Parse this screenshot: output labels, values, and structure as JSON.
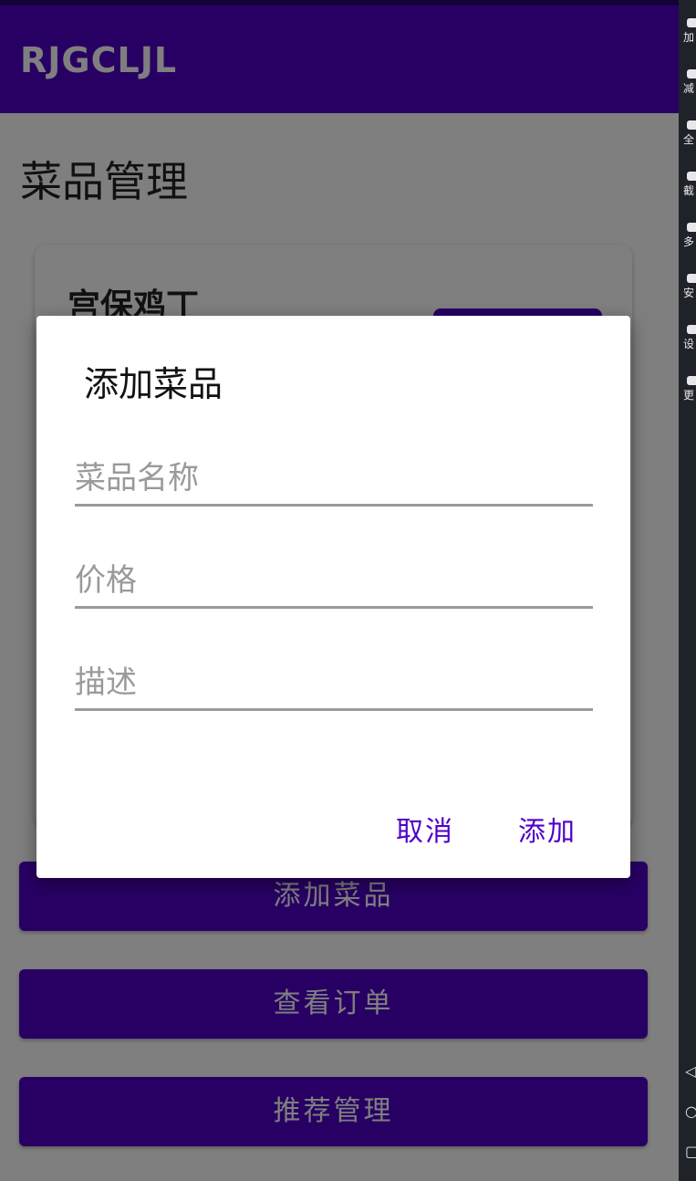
{
  "app": {
    "title": "RJGCLJL"
  },
  "page": {
    "title": "菜品管理",
    "card": {
      "dish_name": "宫保鸡丁"
    },
    "buttons": {
      "add": "添加菜品",
      "orders": "查看订单",
      "recommend": "推荐管理"
    }
  },
  "dialog": {
    "title": "添加菜品",
    "fields": {
      "name_placeholder": "菜品名称",
      "price_placeholder": "价格",
      "desc_placeholder": "描述"
    },
    "cancel": "取消",
    "confirm": "添加"
  },
  "sidebar": {
    "items": [
      {
        "icon": "volume-up-icon",
        "label": "加"
      },
      {
        "icon": "volume-down-icon",
        "label": "减"
      },
      {
        "icon": "fullscreen-icon",
        "label": "全"
      },
      {
        "icon": "scissors-icon",
        "label": "截"
      },
      {
        "icon": "multi-window-icon",
        "label": "多"
      },
      {
        "icon": "install-icon",
        "label": "安"
      },
      {
        "icon": "settings-icon",
        "label": "设"
      },
      {
        "icon": "more-icon",
        "label": "更"
      }
    ],
    "nav": {
      "back": "◁",
      "home": "○",
      "recent": "▢"
    }
  },
  "colors": {
    "accent": "#5000c8",
    "scrim": "rgba(0,0,0,0.5)",
    "sidebar_bg": "#1f2229"
  }
}
